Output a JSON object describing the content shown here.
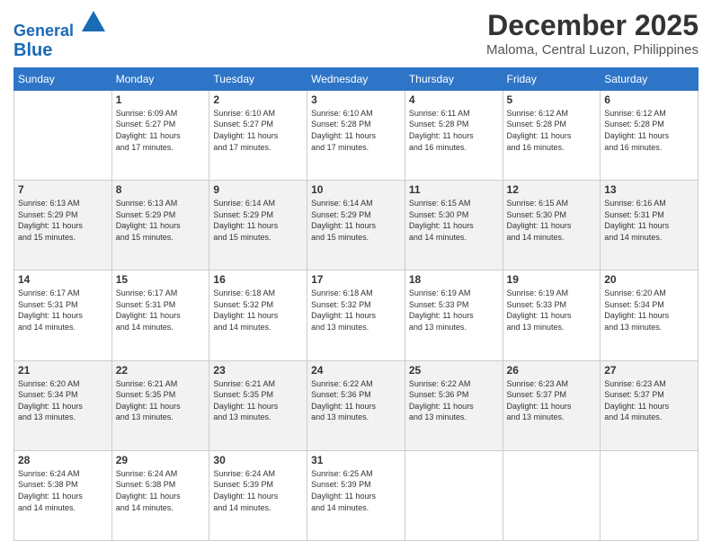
{
  "header": {
    "logo_line1": "General",
    "logo_line2": "Blue",
    "month": "December 2025",
    "location": "Maloma, Central Luzon, Philippines"
  },
  "weekdays": [
    "Sunday",
    "Monday",
    "Tuesday",
    "Wednesday",
    "Thursday",
    "Friday",
    "Saturday"
  ],
  "weeks": [
    [
      {
        "day": "",
        "text": ""
      },
      {
        "day": "1",
        "text": "Sunrise: 6:09 AM\nSunset: 5:27 PM\nDaylight: 11 hours\nand 17 minutes."
      },
      {
        "day": "2",
        "text": "Sunrise: 6:10 AM\nSunset: 5:27 PM\nDaylight: 11 hours\nand 17 minutes."
      },
      {
        "day": "3",
        "text": "Sunrise: 6:10 AM\nSunset: 5:28 PM\nDaylight: 11 hours\nand 17 minutes."
      },
      {
        "day": "4",
        "text": "Sunrise: 6:11 AM\nSunset: 5:28 PM\nDaylight: 11 hours\nand 16 minutes."
      },
      {
        "day": "5",
        "text": "Sunrise: 6:12 AM\nSunset: 5:28 PM\nDaylight: 11 hours\nand 16 minutes."
      },
      {
        "day": "6",
        "text": "Sunrise: 6:12 AM\nSunset: 5:28 PM\nDaylight: 11 hours\nand 16 minutes."
      }
    ],
    [
      {
        "day": "7",
        "text": "Sunrise: 6:13 AM\nSunset: 5:29 PM\nDaylight: 11 hours\nand 15 minutes."
      },
      {
        "day": "8",
        "text": "Sunrise: 6:13 AM\nSunset: 5:29 PM\nDaylight: 11 hours\nand 15 minutes."
      },
      {
        "day": "9",
        "text": "Sunrise: 6:14 AM\nSunset: 5:29 PM\nDaylight: 11 hours\nand 15 minutes."
      },
      {
        "day": "10",
        "text": "Sunrise: 6:14 AM\nSunset: 5:29 PM\nDaylight: 11 hours\nand 15 minutes."
      },
      {
        "day": "11",
        "text": "Sunrise: 6:15 AM\nSunset: 5:30 PM\nDaylight: 11 hours\nand 14 minutes."
      },
      {
        "day": "12",
        "text": "Sunrise: 6:15 AM\nSunset: 5:30 PM\nDaylight: 11 hours\nand 14 minutes."
      },
      {
        "day": "13",
        "text": "Sunrise: 6:16 AM\nSunset: 5:31 PM\nDaylight: 11 hours\nand 14 minutes."
      }
    ],
    [
      {
        "day": "14",
        "text": "Sunrise: 6:17 AM\nSunset: 5:31 PM\nDaylight: 11 hours\nand 14 minutes."
      },
      {
        "day": "15",
        "text": "Sunrise: 6:17 AM\nSunset: 5:31 PM\nDaylight: 11 hours\nand 14 minutes."
      },
      {
        "day": "16",
        "text": "Sunrise: 6:18 AM\nSunset: 5:32 PM\nDaylight: 11 hours\nand 14 minutes."
      },
      {
        "day": "17",
        "text": "Sunrise: 6:18 AM\nSunset: 5:32 PM\nDaylight: 11 hours\nand 13 minutes."
      },
      {
        "day": "18",
        "text": "Sunrise: 6:19 AM\nSunset: 5:33 PM\nDaylight: 11 hours\nand 13 minutes."
      },
      {
        "day": "19",
        "text": "Sunrise: 6:19 AM\nSunset: 5:33 PM\nDaylight: 11 hours\nand 13 minutes."
      },
      {
        "day": "20",
        "text": "Sunrise: 6:20 AM\nSunset: 5:34 PM\nDaylight: 11 hours\nand 13 minutes."
      }
    ],
    [
      {
        "day": "21",
        "text": "Sunrise: 6:20 AM\nSunset: 5:34 PM\nDaylight: 11 hours\nand 13 minutes."
      },
      {
        "day": "22",
        "text": "Sunrise: 6:21 AM\nSunset: 5:35 PM\nDaylight: 11 hours\nand 13 minutes."
      },
      {
        "day": "23",
        "text": "Sunrise: 6:21 AM\nSunset: 5:35 PM\nDaylight: 11 hours\nand 13 minutes."
      },
      {
        "day": "24",
        "text": "Sunrise: 6:22 AM\nSunset: 5:36 PM\nDaylight: 11 hours\nand 13 minutes."
      },
      {
        "day": "25",
        "text": "Sunrise: 6:22 AM\nSunset: 5:36 PM\nDaylight: 11 hours\nand 13 minutes."
      },
      {
        "day": "26",
        "text": "Sunrise: 6:23 AM\nSunset: 5:37 PM\nDaylight: 11 hours\nand 13 minutes."
      },
      {
        "day": "27",
        "text": "Sunrise: 6:23 AM\nSunset: 5:37 PM\nDaylight: 11 hours\nand 14 minutes."
      }
    ],
    [
      {
        "day": "28",
        "text": "Sunrise: 6:24 AM\nSunset: 5:38 PM\nDaylight: 11 hours\nand 14 minutes."
      },
      {
        "day": "29",
        "text": "Sunrise: 6:24 AM\nSunset: 5:38 PM\nDaylight: 11 hours\nand 14 minutes."
      },
      {
        "day": "30",
        "text": "Sunrise: 6:24 AM\nSunset: 5:39 PM\nDaylight: 11 hours\nand 14 minutes."
      },
      {
        "day": "31",
        "text": "Sunrise: 6:25 AM\nSunset: 5:39 PM\nDaylight: 11 hours\nand 14 minutes."
      },
      {
        "day": "",
        "text": ""
      },
      {
        "day": "",
        "text": ""
      },
      {
        "day": "",
        "text": ""
      }
    ]
  ]
}
